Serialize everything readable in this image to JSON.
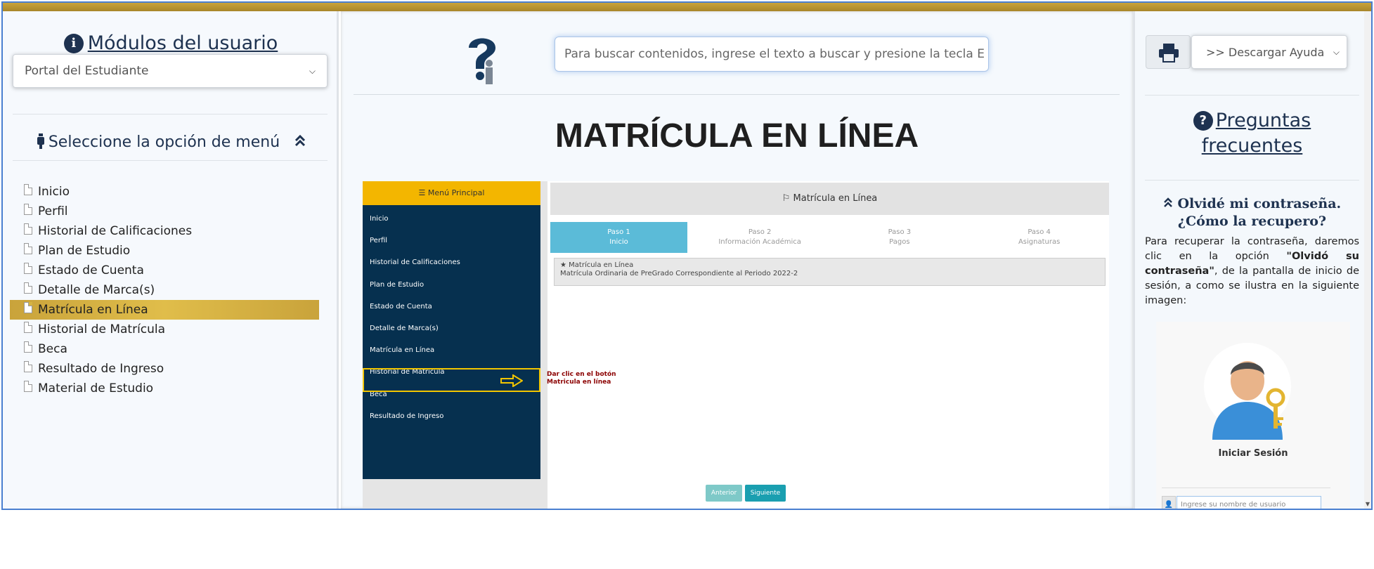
{
  "left": {
    "modules_title": "Módulos del usuario",
    "module_select": "Portal del Estudiante",
    "menu_heading": "Seleccione la opción de menú",
    "menu_items": [
      {
        "label": "Inicio",
        "active": false
      },
      {
        "label": "Perfil",
        "active": false
      },
      {
        "label": "Historial de Calificaciones",
        "active": false
      },
      {
        "label": "Plan de Estudio",
        "active": false
      },
      {
        "label": "Estado de Cuenta",
        "active": false
      },
      {
        "label": "Detalle de Marca(s)",
        "active": false
      },
      {
        "label": "Matrícula en Línea",
        "active": true
      },
      {
        "label": "Historial de Matrícula",
        "active": false
      },
      {
        "label": "Beca",
        "active": false
      },
      {
        "label": "Resultado de Ingreso",
        "active": false
      },
      {
        "label": "Material de Estudio",
        "active": false
      }
    ]
  },
  "middle": {
    "search_placeholder": "Para buscar contenidos, ingrese el texto a buscar y presione la tecla E",
    "page_title": "MATRÍCULA EN LÍNEA",
    "screenshot": {
      "menu_header": "☰ Menú Principal",
      "menu_items": [
        "Inicio",
        "Perfil",
        "Historial de Calificaciones",
        "Plan de Estudio",
        "Estado de Cuenta",
        "Detalle de Marca(s)",
        "Matrícula en Línea",
        "Historial de Matrícula",
        "Beca",
        "Resultado de Ingreso"
      ],
      "note_line1": "Dar clic en el botón",
      "note_line2": "Matricula en línea",
      "panel_title": "Matrícula en Línea",
      "steps": [
        {
          "name": "Paso 1",
          "desc": "Inicio"
        },
        {
          "name": "Paso 2",
          "desc": "Información Académica"
        },
        {
          "name": "Paso 3",
          "desc": "Pagos"
        },
        {
          "name": "Paso 4",
          "desc": "Asignaturas"
        }
      ],
      "notice_line1": "Matrícula en Línea",
      "notice_line2": "Matrícula Ordinaria de PreGrado Correspondiente al Periodo 2022-2",
      "btn_prev": "Anterior",
      "btn_next": "Siguiente"
    }
  },
  "right": {
    "download_select": ">> Descargar Ayuda",
    "faq_title_1": "Preguntas",
    "faq_title_2": "frecuentes",
    "question": "Olvidé mi contraseña. ¿Cómo la recupero?",
    "answer_part1": "Para recuperar la contraseña, daremos clic en la opción ",
    "answer_bold": "\"Olvidó su contraseña\"",
    "answer_part2": ", de la pantalla de inicio de sesión, a como se ilustra en la siguiente imagen:",
    "login_label": "Iniciar Sesión",
    "username_placeholder": "Ingrese su nombre de usuario"
  },
  "colors": {
    "gold": "#c9a33b",
    "navy": "#1e3250",
    "menu_dark": "#06304f",
    "step_active": "#5bbbd8"
  }
}
